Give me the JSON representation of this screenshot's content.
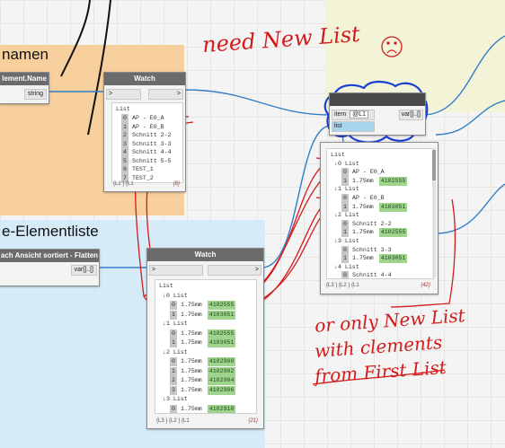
{
  "groups": {
    "orange_title": "namen",
    "blue_title": "e-Elementliste"
  },
  "nodes": {
    "element_name": {
      "title": "lement.Name",
      "output": "string"
    },
    "watch1": {
      "title": "Watch",
      "in": ">",
      "out": ">",
      "root": "List",
      "rows": [
        {
          "i": "0",
          "text": "AP -  E0_A"
        },
        {
          "i": "1",
          "text": "AP -  E0_B"
        },
        {
          "i": "2",
          "text": "Schnitt 2-2"
        },
        {
          "i": "3",
          "text": "Schnitt 3-3"
        },
        {
          "i": "4",
          "text": "Schnitt 4-4"
        },
        {
          "i": "5",
          "text": "Schnitt 5-5"
        },
        {
          "i": "6",
          "text": "TEST_1"
        },
        {
          "i": "7",
          "text": "TEST_2"
        }
      ],
      "footer": "{L2 } {L1",
      "count": "{8}"
    },
    "sorted_node": {
      "title": "ach Ansicht sortiert -  Flatten",
      "output": "var[]..[]"
    },
    "watch2": {
      "title": "Watch",
      "in": ">",
      "out": ">",
      "rows": [
        {
          "t": "h",
          "text": "List"
        },
        {
          "t": "h",
          "text": "0 List"
        },
        {
          "t": "v",
          "i": "0",
          "text": "1.75mm",
          "v": "4102555"
        },
        {
          "t": "v",
          "i": "1",
          "text": "1.75mm",
          "v": "4103051"
        },
        {
          "t": "h",
          "text": "1 List"
        },
        {
          "t": "v",
          "i": "0",
          "text": "1.75mm",
          "v": "4102555"
        },
        {
          "t": "v",
          "i": "1",
          "text": "1.75mm",
          "v": "4103051"
        },
        {
          "t": "h",
          "text": "2 List"
        },
        {
          "t": "v",
          "i": "0",
          "text": "1.75mm",
          "v": "4102900"
        },
        {
          "t": "v",
          "i": "1",
          "text": "1.75mm",
          "v": "4102902"
        },
        {
          "t": "v",
          "i": "2",
          "text": "1.75mm",
          "v": "4102904"
        },
        {
          "t": "v",
          "i": "3",
          "text": "1.75mm",
          "v": "4102906"
        },
        {
          "t": "h",
          "text": "3 List"
        },
        {
          "t": "v",
          "i": "0",
          "text": "1.75mm",
          "v": "4102910"
        }
      ],
      "footer": "{L3 } {L2 } {L1",
      "count": "{21}"
    },
    "newlist": {
      "item_label": "item",
      "item_value": "@L1",
      "list_label": "list",
      "output": "var[]..[]"
    },
    "watch3": {
      "rows": [
        {
          "t": "h",
          "text": "List"
        },
        {
          "t": "h",
          "text": "0 List"
        },
        {
          "t": "v",
          "i": "0",
          "text": "AP -  E0_A",
          "v": ""
        },
        {
          "t": "v",
          "i": "1",
          "text": "1.75mm",
          "v": "4102555"
        },
        {
          "t": "h",
          "text": "1 List"
        },
        {
          "t": "v",
          "i": "0",
          "text": "AP -  E0_B",
          "v": ""
        },
        {
          "t": "v",
          "i": "1",
          "text": "1.75mm",
          "v": "4103051"
        },
        {
          "t": "h",
          "text": "2 List"
        },
        {
          "t": "v",
          "i": "0",
          "text": "Schnitt 2-2",
          "v": ""
        },
        {
          "t": "v",
          "i": "1",
          "text": "1.75mm",
          "v": "4102555"
        },
        {
          "t": "h",
          "text": "3 List"
        },
        {
          "t": "v",
          "i": "0",
          "text": "Schnitt 3-3",
          "v": ""
        },
        {
          "t": "v",
          "i": "1",
          "text": "1.75mm",
          "v": "4103051"
        },
        {
          "t": "h",
          "text": "4 List"
        },
        {
          "t": "v",
          "i": "0",
          "text": "Schnitt 4-4",
          "v": ""
        }
      ],
      "footer": "{L3 } {L2 } {L1",
      "count": "{42}"
    }
  },
  "annotations": {
    "need": "need New List",
    "or1": "or only New List",
    "or2": "with clements",
    "or3": "from First List"
  },
  "colors": {
    "orange": "#f7cf9c",
    "blue": "#cfe9f7",
    "yellow": "#f3f3d8",
    "ink": "#d21b1b",
    "wire": "#2f7fc8",
    "value": "#9ed48c"
  }
}
